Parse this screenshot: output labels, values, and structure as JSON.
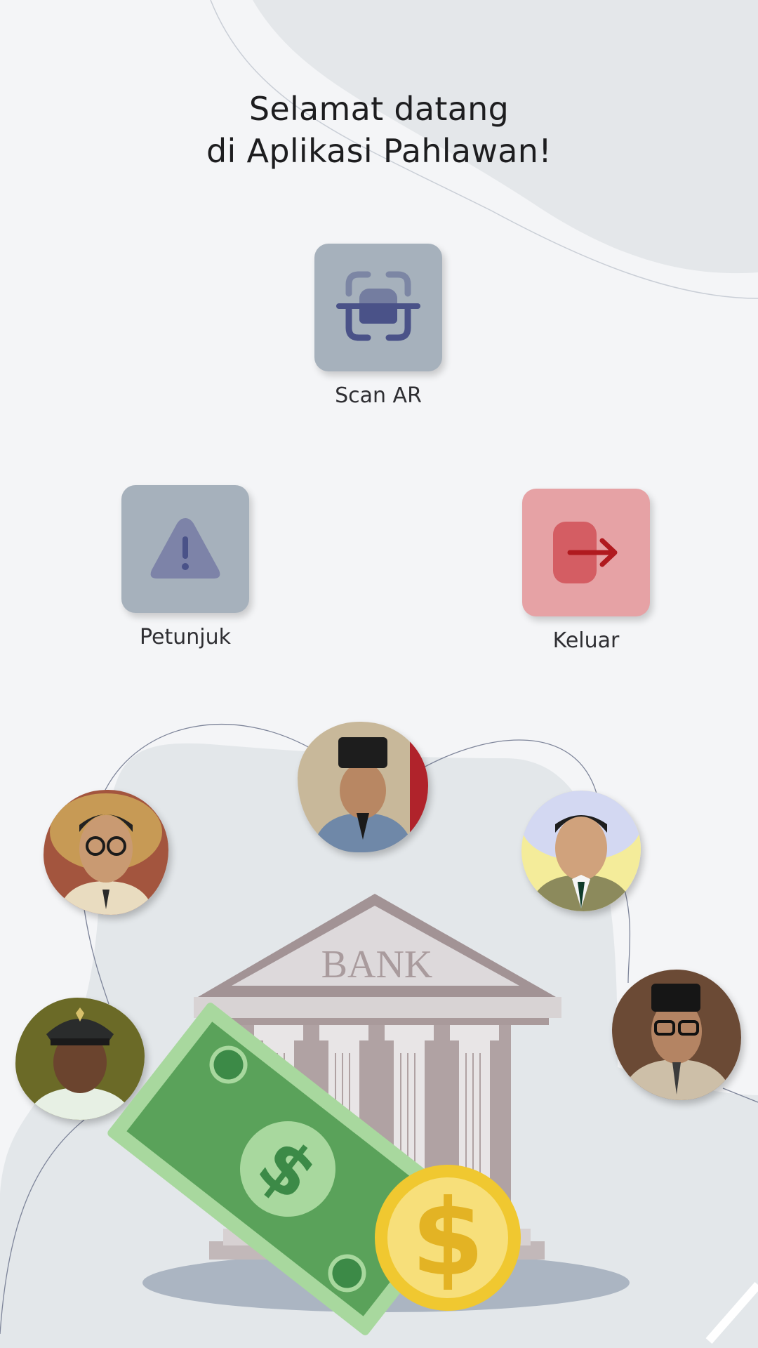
{
  "header": {
    "title_line1": "Selamat datang",
    "title_line2": "di Aplikasi Pahlawan!"
  },
  "menu": {
    "scan": {
      "label": "Scan AR",
      "icon": "scan-ar-icon"
    },
    "help": {
      "label": "Petunjuk",
      "icon": "warning-icon"
    },
    "exit": {
      "label": "Keluar",
      "icon": "logout-icon"
    }
  },
  "illustration": {
    "bank_sign": "BANK"
  },
  "colors": {
    "tile_grey": "#a6b1bc",
    "tile_red": "#e6a2a5",
    "icon_navy": "#4a5288",
    "icon_red": "#b01a1f"
  }
}
